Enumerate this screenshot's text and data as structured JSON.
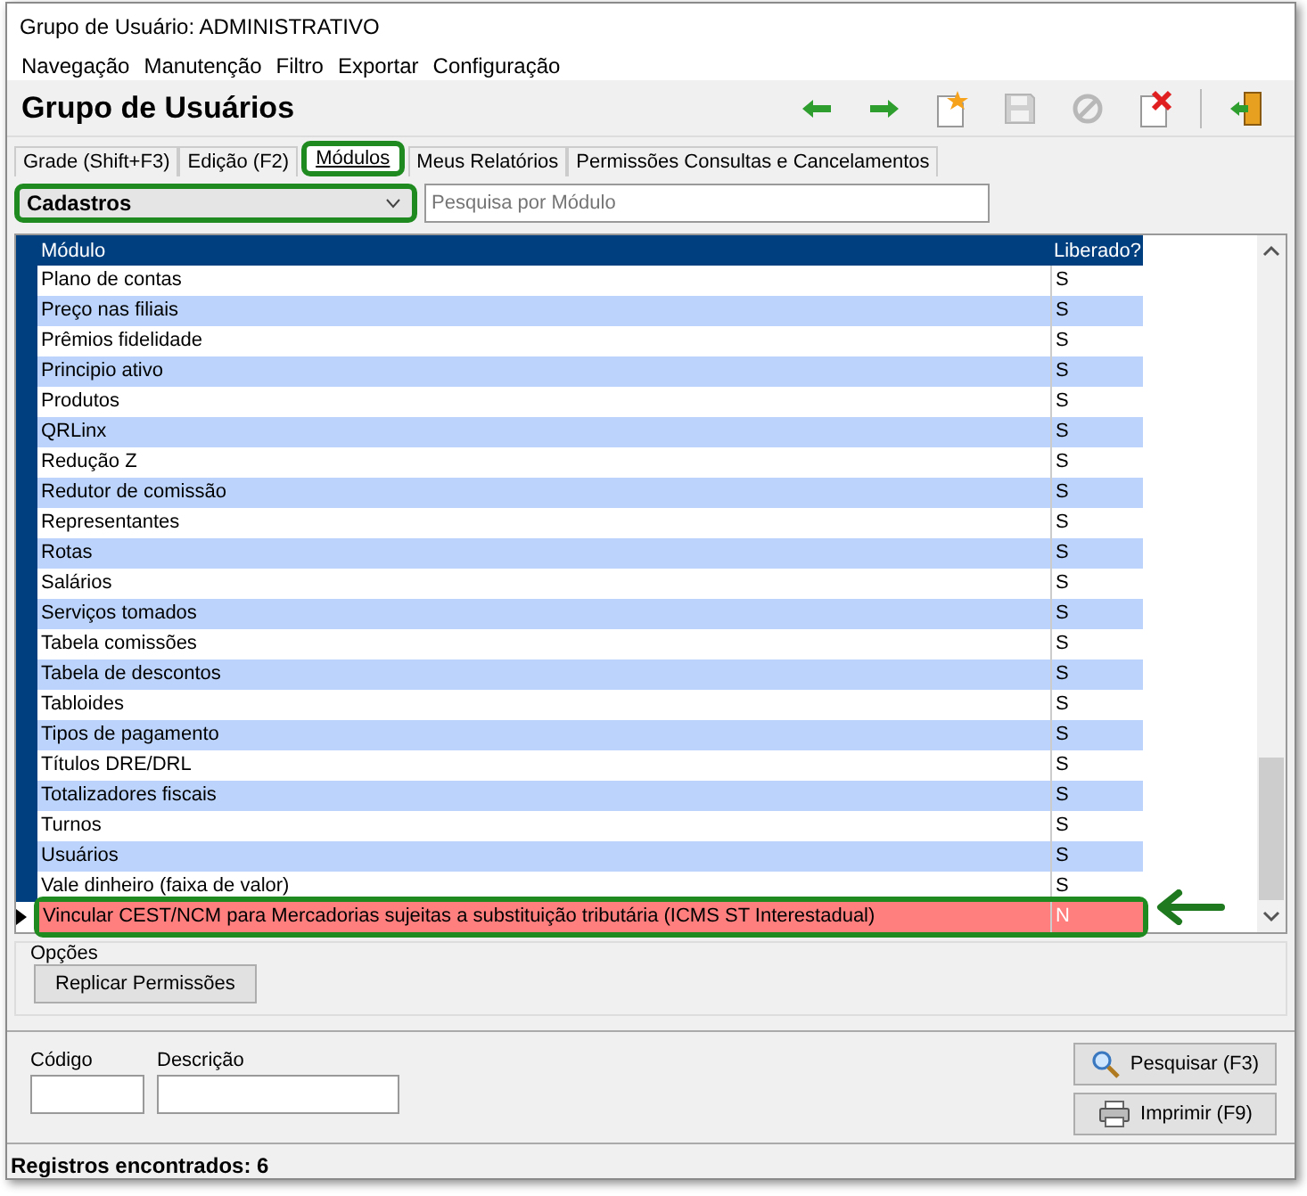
{
  "window": {
    "title": "Grupo de Usuário: ADMINISTRATIVO"
  },
  "menu": [
    "Navegação",
    "Manutenção",
    "Filtro",
    "Exportar",
    "Configuração"
  ],
  "header": {
    "title": "Grupo de Usuários"
  },
  "toolbar": [
    {
      "kind": "back",
      "disabled": false
    },
    {
      "kind": "forward",
      "disabled": false
    },
    {
      "kind": "new",
      "disabled": false
    },
    {
      "kind": "save",
      "disabled": true
    },
    {
      "kind": "cancel",
      "disabled": true
    },
    {
      "kind": "delete",
      "disabled": false
    },
    {
      "kind": "exit",
      "disabled": false
    }
  ],
  "tabs": [
    {
      "label": "Grade (Shift+F3)",
      "selected": false
    },
    {
      "label": "Edição (F2)",
      "selected": false
    },
    {
      "label": "Módulos",
      "selected": true
    },
    {
      "label": "Meus Relatórios",
      "selected": false
    },
    {
      "label": "Permissões Consultas e Cancelamentos",
      "selected": false
    }
  ],
  "filter": {
    "value": "Cadastros",
    "highlighted": true
  },
  "search": {
    "placeholder": "Pesquisa por Módulo"
  },
  "table": {
    "columns": [
      "Módulo",
      "Liberado?"
    ],
    "rows": [
      {
        "module": "Plano de contas",
        "released": "S",
        "selected": false
      },
      {
        "module": "Preço nas filiais",
        "released": "S",
        "selected": false
      },
      {
        "module": "Prêmios fidelidade",
        "released": "S",
        "selected": false
      },
      {
        "module": "Principio ativo",
        "released": "S",
        "selected": false
      },
      {
        "module": "Produtos",
        "released": "S",
        "selected": false
      },
      {
        "module": "QRLinx",
        "released": "S",
        "selected": false
      },
      {
        "module": "Redução Z",
        "released": "S",
        "selected": false
      },
      {
        "module": "Redutor de comissão",
        "released": "S",
        "selected": false
      },
      {
        "module": "Representantes",
        "released": "S",
        "selected": false
      },
      {
        "module": "Rotas",
        "released": "S",
        "selected": false
      },
      {
        "module": "Salários",
        "released": "S",
        "selected": false
      },
      {
        "module": "Serviços tomados",
        "released": "S",
        "selected": false
      },
      {
        "module": "Tabela comissões",
        "released": "S",
        "selected": false
      },
      {
        "module": "Tabela de descontos",
        "released": "S",
        "selected": false
      },
      {
        "module": "Tabloides",
        "released": "S",
        "selected": false
      },
      {
        "module": "Tipos de pagamento",
        "released": "S",
        "selected": false
      },
      {
        "module": "Títulos DRE/DRL",
        "released": "S",
        "selected": false
      },
      {
        "module": "Totalizadores fiscais",
        "released": "S",
        "selected": false
      },
      {
        "module": "Turnos",
        "released": "S",
        "selected": false
      },
      {
        "module": "Usuários",
        "released": "S",
        "selected": false
      },
      {
        "module": "Vale dinheiro (faixa de valor)",
        "released": "S",
        "selected": false
      },
      {
        "module": "Vincular CEST/NCM para Mercadorias sujeitas a substituição tributária (ICMS ST Interestadual)",
        "released": "N",
        "selected": true
      }
    ]
  },
  "options": {
    "title": "Opções",
    "button": "Replicar Permissões"
  },
  "search_panel": {
    "fields": [
      {
        "label": "Código"
      },
      {
        "label": "Descrição"
      }
    ],
    "buttons": [
      {
        "kind": "search",
        "label": "Pesquisar (F3)"
      },
      {
        "kind": "print",
        "label": "Imprimir (F9)"
      }
    ]
  },
  "status_bar": "Registros encontrados: 6"
}
